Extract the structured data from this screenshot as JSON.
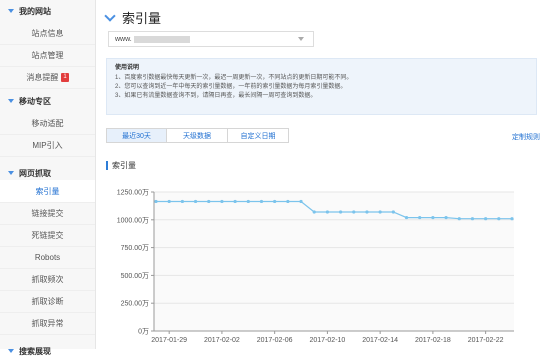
{
  "sidebar": {
    "groups": [
      {
        "label": "我的网站",
        "items": [
          {
            "label": "站点信息"
          },
          {
            "label": "站点管理"
          },
          {
            "label": "消息提醒",
            "badge": "1"
          }
        ]
      },
      {
        "label": "移动专区",
        "items": [
          {
            "label": "移动适配"
          },
          {
            "label": "MIP引入"
          }
        ]
      },
      {
        "label": "网页抓取",
        "items": [
          {
            "label": "索引量",
            "active": true
          },
          {
            "label": "链接提交"
          },
          {
            "label": "死链提交"
          },
          {
            "label": "Robots"
          },
          {
            "label": "抓取频次"
          },
          {
            "label": "抓取诊断"
          },
          {
            "label": "抓取异常"
          }
        ]
      },
      {
        "label": "搜索展现"
      }
    ]
  },
  "page": {
    "title": "索引量",
    "site_select": {
      "value": "www."
    },
    "notice": {
      "title": "使用说明",
      "lines": [
        "1、百度索引数据最快每天更新一次，最迟一周更新一次，不同站点的更新日期可能不同。",
        "2、您可以查询到近一年中每天的索引量数据，一年前的索引量数据为每月索引量数据。",
        "3、如果已有流量数据查询不到，请隔日再查，最长间隔一周可查询到数据。"
      ]
    },
    "tabs": [
      {
        "label": "最近30天",
        "active": true
      },
      {
        "label": "天级数据"
      },
      {
        "label": "自定义日期"
      }
    ],
    "custom_rule_label": "定制规则",
    "section_title": "索引量"
  },
  "colors": {
    "accent": "#2e7dd7",
    "series": "#7cc4ec",
    "badge": "#e23d3d"
  },
  "chart_data": {
    "type": "line",
    "y_tick_labels": [
      "0万",
      "250.00万",
      "500.00万",
      "750.00万",
      "1000.00万",
      "1250.00万"
    ],
    "ylim": [
      0,
      1250
    ],
    "x_tick_labels": [
      "2017-01-29",
      "2017-02-02",
      "2017-02-06",
      "2017-02-10",
      "2017-02-14",
      "2017-02-18",
      "2017-02-22"
    ],
    "x": [
      "2017-01-28",
      "2017-01-29",
      "2017-01-30",
      "2017-01-31",
      "2017-02-01",
      "2017-02-02",
      "2017-02-03",
      "2017-02-04",
      "2017-02-05",
      "2017-02-06",
      "2017-02-07",
      "2017-02-08",
      "2017-02-09",
      "2017-02-10",
      "2017-02-11",
      "2017-02-12",
      "2017-02-13",
      "2017-02-14",
      "2017-02-15",
      "2017-02-16",
      "2017-02-17",
      "2017-02-18",
      "2017-02-19",
      "2017-02-20",
      "2017-02-21",
      "2017-02-22",
      "2017-02-23",
      "2017-02-24"
    ],
    "series": [
      {
        "values": [
          1165,
          1165,
          1165,
          1165,
          1165,
          1165,
          1165,
          1165,
          1165,
          1165,
          1165,
          1165,
          1070,
          1070,
          1070,
          1070,
          1070,
          1070,
          1070,
          1020,
          1020,
          1020,
          1020,
          1010,
          1010,
          1010,
          1010,
          1010
        ]
      }
    ]
  }
}
